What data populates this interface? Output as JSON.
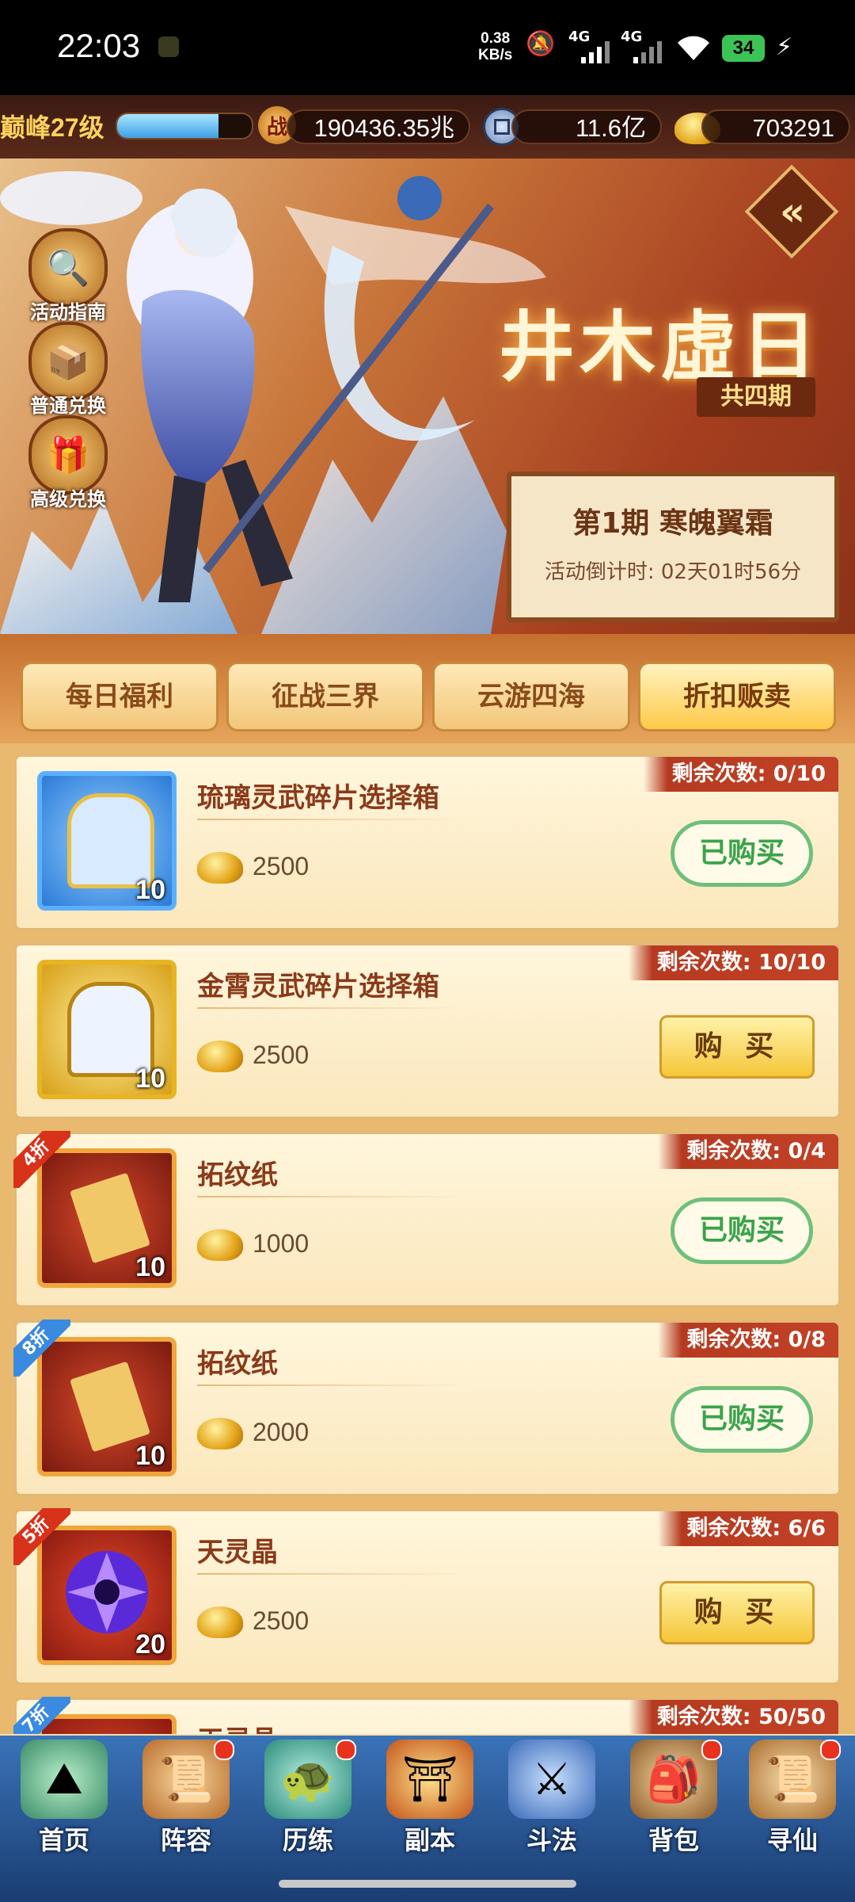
{
  "status_bar": {
    "time": "22:03",
    "net_speed_value": "0.38",
    "net_speed_unit": "KB/s",
    "network_1": "4G",
    "network_2": "4G",
    "battery": "34"
  },
  "player": {
    "level": "巅峰27级",
    "level_progress": 0.75,
    "combat_icon": "战",
    "combat_power": "190436.35兆",
    "coins": "11.6亿",
    "gold_ingots": "703291"
  },
  "banner": {
    "event_title": "井木虛日",
    "periods": "共四期",
    "current_period": "第1期  寒魄翼霜",
    "countdown": "活动倒计时: 02天01时56分"
  },
  "side_buttons": [
    {
      "label": "活动指南",
      "icon": "magnifier-icon"
    },
    {
      "label": "普通兑换",
      "icon": "chest-icon"
    },
    {
      "label": "高级兑换",
      "icon": "gift-icon"
    }
  ],
  "tabs": [
    {
      "label": "每日福利",
      "active": false
    },
    {
      "label": "征战三界",
      "active": false
    },
    {
      "label": "云游四海",
      "active": false
    },
    {
      "label": "折扣贩卖",
      "active": true
    }
  ],
  "items": [
    {
      "name": "琉璃灵武碎片选择箱",
      "count": "10",
      "price": "2500",
      "remaining": "剩余次数: 0/10",
      "button": "已购买",
      "bought": true,
      "discount": ""
    },
    {
      "name": "金霄灵武碎片选择箱",
      "count": "10",
      "price": "2500",
      "remaining": "剩余次数: 10/10",
      "button": "购 买",
      "bought": false,
      "discount": ""
    },
    {
      "name": "拓纹纸",
      "count": "10",
      "price": "1000",
      "remaining": "剩余次数: 0/4",
      "button": "已购买",
      "bought": true,
      "discount": "4折"
    },
    {
      "name": "拓纹纸",
      "count": "10",
      "price": "2000",
      "remaining": "剩余次数: 0/8",
      "button": "已购买",
      "bought": true,
      "discount": "8折"
    },
    {
      "name": "天灵晶",
      "count": "20",
      "price": "2500",
      "remaining": "剩余次数: 6/6",
      "button": "购 买",
      "bought": false,
      "discount": "5折"
    },
    {
      "name": "天灵晶",
      "count": "",
      "price": "",
      "remaining": "剩余次数: 50/50",
      "button": "",
      "bought": false,
      "discount": "7折"
    }
  ],
  "bottom_nav": [
    {
      "label": "首页",
      "icon": "home-icon",
      "badge": false
    },
    {
      "label": "阵容",
      "icon": "lineup-icon",
      "badge": true
    },
    {
      "label": "历练",
      "icon": "training-icon",
      "badge": true
    },
    {
      "label": "副本",
      "icon": "dungeon-icon",
      "badge": false
    },
    {
      "label": "斗法",
      "icon": "battle-icon",
      "badge": false
    },
    {
      "label": "背包",
      "icon": "bag-icon",
      "badge": true
    },
    {
      "label": "寻仙",
      "icon": "seek-icon",
      "badge": true
    }
  ],
  "colors": {
    "accent_gold": "#ffd35c",
    "tag_red": "#c24226",
    "bought_green": "#3aa34a",
    "nav_blue": "#2a5a9a"
  }
}
